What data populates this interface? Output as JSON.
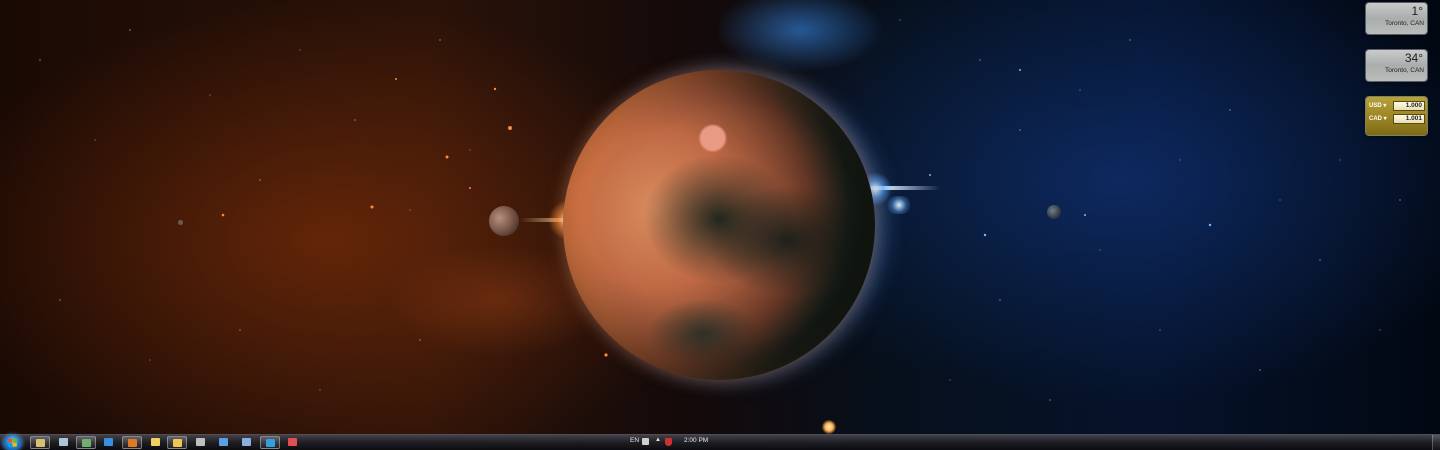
{
  "gadgets": {
    "weather": [
      {
        "temperature": "1°",
        "location": "Toronto, CAN"
      },
      {
        "temperature": "34°",
        "location": "Toronto, CAN"
      }
    ],
    "currency": {
      "rows": [
        {
          "code": "USD",
          "value": "1.000"
        },
        {
          "code": "CAD",
          "value": "1.001"
        }
      ]
    }
  },
  "taskbar": {
    "start": {
      "icon": "windows-start-orb-icon"
    },
    "apps": [
      {
        "icon": "windows-explorer-icon",
        "pinned": true,
        "color": "#d8c070"
      },
      {
        "icon": "app-icon",
        "pinned": false,
        "color": "#b0c4d8"
      },
      {
        "icon": "network-map-icon",
        "pinned": true,
        "color": "#6fb06f"
      },
      {
        "icon": "internet-explorer-icon",
        "pinned": false,
        "color": "#3a8fe0"
      },
      {
        "icon": "firefox-icon",
        "pinned": true,
        "color": "#e07a20"
      },
      {
        "icon": "sticky-notes-icon",
        "pinned": false,
        "color": "#f0d060"
      },
      {
        "icon": "folder-icon",
        "pinned": true,
        "color": "#f0c850"
      },
      {
        "icon": "app-icon",
        "pinned": false,
        "color": "#c0c0c0"
      },
      {
        "icon": "app-icon",
        "pinned": false,
        "color": "#5aa0e0"
      },
      {
        "icon": "remote-desktop-icon",
        "pinned": false,
        "color": "#8ab0e0"
      },
      {
        "icon": "skype-icon",
        "pinned": true,
        "color": "#30a0e0"
      },
      {
        "icon": "app-icon",
        "pinned": false,
        "color": "#e05050"
      }
    ],
    "tray": {
      "language": "EN",
      "clock": "2:00 PM"
    }
  }
}
